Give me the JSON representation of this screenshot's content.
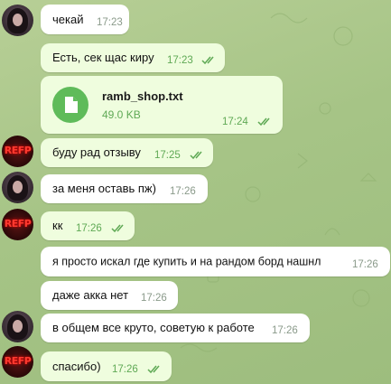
{
  "messages": [
    {
      "text": "чекай",
      "time": "17:23",
      "sender": "other",
      "avatar": "girl",
      "checks": false
    },
    {
      "text": "Есть, сек щас киру",
      "time": "17:23",
      "sender": "self",
      "checks": true
    },
    {
      "file": {
        "name": "ramb_shop.txt",
        "size": "49.0 KB",
        "icon": "file-icon"
      },
      "time": "17:24",
      "sender": "self",
      "checks": true
    },
    {
      "text": "буду рад отзыву",
      "time": "17:25",
      "sender": "self",
      "checks": true
    },
    {
      "text": "за меня оставь пж)",
      "time": "17:26",
      "sender": "other",
      "avatar": "girl",
      "checks": false
    },
    {
      "text": "кк",
      "time": "17:26",
      "sender": "self",
      "checks": true
    },
    {
      "text": "я просто искал где купить и на рандом борд нашнл",
      "time": "17:26",
      "sender": "other",
      "checks": false
    },
    {
      "text": "даже акка нет",
      "time": "17:26",
      "sender": "other",
      "checks": false
    },
    {
      "text": "в общем все круто, советую к работе",
      "time": "17:26",
      "sender": "other",
      "avatar": "girl",
      "checks": false
    },
    {
      "text": "спасибо)",
      "time": "17:26",
      "sender": "self",
      "checks": true
    }
  ],
  "avatars": {
    "refp_logo": "REFP"
  },
  "colors": {
    "outgoing_bubble": "#effdde",
    "incoming_bubble": "#ffffff",
    "read_check": "#5fa955",
    "file_icon": "#5fbb5a"
  }
}
